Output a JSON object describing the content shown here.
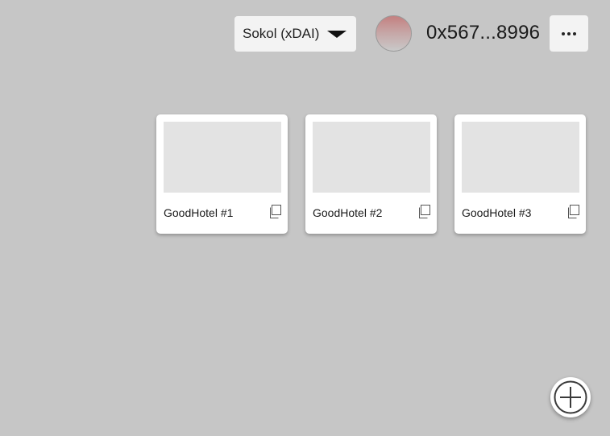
{
  "header": {
    "network_select": {
      "selected": "Sokol (xDAI)",
      "icon": "caret-down-icon"
    },
    "account": {
      "avatar": "account-avatar",
      "address": "0x567...8996"
    },
    "more_menu": {
      "icon": "more-horizontal-icon"
    }
  },
  "cards": [
    {
      "title": "GoodHotel #1",
      "icon": "copy-icon"
    },
    {
      "title": "GoodHotel #2",
      "icon": "copy-icon"
    },
    {
      "title": "GoodHotel #3",
      "icon": "copy-icon"
    }
  ],
  "fab": {
    "icon": "plus-circle-icon"
  },
  "colors": {
    "background": "#c6c6c6",
    "card": "#ffffff",
    "thumbnail": "#e3e3e3",
    "button": "#f3f3f3"
  }
}
